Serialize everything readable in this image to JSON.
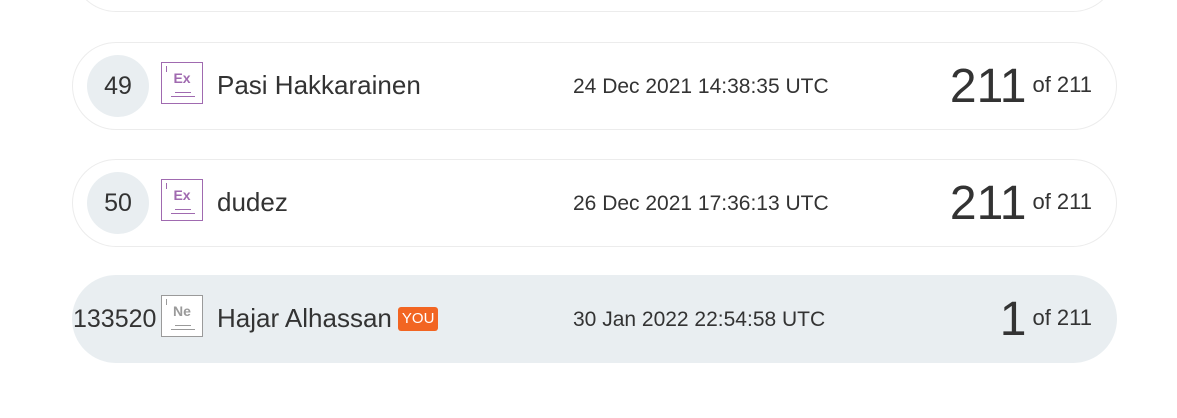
{
  "rows": [
    {
      "rank": "49",
      "level_symbol": "Ex",
      "name": "Pasi Hakkarainen",
      "date": "24 Dec 2021 14:38:35 UTC",
      "score": "211",
      "total": "of 211"
    },
    {
      "rank": "50",
      "level_symbol": "Ex",
      "name": "dudez",
      "date": "26 Dec 2021 17:36:13 UTC",
      "score": "211",
      "total": "of 211"
    },
    {
      "rank": "133520",
      "level_symbol": "Ne",
      "name": "Hajar Alhassan",
      "badge": "YOU",
      "date": "30 Jan 2022 22:54:58 UTC",
      "score": "1",
      "total": "of 211"
    }
  ],
  "colors": {
    "level_expert": "#a06ab0",
    "level_newbie": "#9a9a9a",
    "you_badge": "#f26522",
    "highlight_row": "#e9eef1"
  }
}
